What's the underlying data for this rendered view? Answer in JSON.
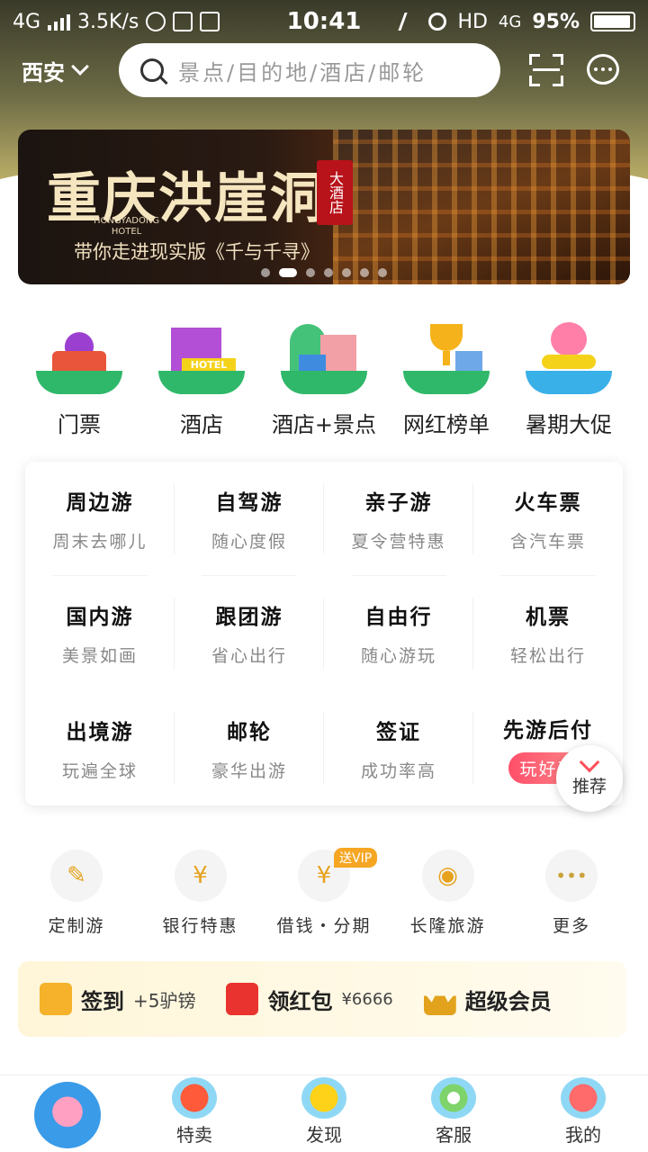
{
  "status": {
    "network": "4G",
    "speed": "3.5K/s",
    "time": "10:41",
    "hd": "HD",
    "network2": "4G",
    "battery": "95%",
    "battery_level": 0.95
  },
  "header": {
    "city": "西安",
    "search_placeholder": "景点/目的地/酒店/邮轮"
  },
  "banner": {
    "title": "重庆洪崖洞",
    "seal": "大酒店",
    "en_line1": "HONGYADONG",
    "en_line2": "HOTEL",
    "subtitle": "带你走进现实版《千与千寻》",
    "dot_count": 7,
    "active_dot": 1
  },
  "categories": [
    {
      "label": "门票",
      "icon": "temple-ticket-icon"
    },
    {
      "label": "酒店",
      "icon": "hotel-icon"
    },
    {
      "label": "酒店+景点",
      "icon": "hotel-scenic-icon"
    },
    {
      "label": "网红榜单",
      "icon": "trophy-icon"
    },
    {
      "label": "暑期大促",
      "icon": "summer-donkey-icon"
    }
  ],
  "grid": [
    {
      "title": "周边游",
      "sub": "周末去哪儿"
    },
    {
      "title": "自驾游",
      "sub": "随心度假"
    },
    {
      "title": "亲子游",
      "sub": "夏令营特惠"
    },
    {
      "title": "火车票",
      "sub": "含汽车票"
    },
    {
      "title": "国内游",
      "sub": "美景如画"
    },
    {
      "title": "跟团游",
      "sub": "省心出行"
    },
    {
      "title": "自由行",
      "sub": "随心游玩"
    },
    {
      "title": "机票",
      "sub": "轻松出行"
    },
    {
      "title": "出境游",
      "sub": "玩遍全球"
    },
    {
      "title": "邮轮",
      "sub": "豪华出游"
    },
    {
      "title": "签证",
      "sub": "成功率高"
    },
    {
      "title": "先游后付",
      "sub": "玩好再"
    }
  ],
  "recommend": {
    "label": "推荐"
  },
  "services": [
    {
      "label": "定制游",
      "icon": "pencil-icon"
    },
    {
      "label": "银行特惠",
      "icon": "bank-house-icon"
    },
    {
      "label": "借钱・分期",
      "icon": "money-bag-icon",
      "badge": "送VIP"
    },
    {
      "label": "长隆旅游",
      "icon": "tiger-icon"
    },
    {
      "label": "更多",
      "icon": "more-dots-icon"
    }
  ],
  "member": {
    "checkin": "签到",
    "checkin_reward": "+5驴镑",
    "redpacket": "领红包",
    "redpacket_amount": "¥6666",
    "vip": "超级会员"
  },
  "tabbar": [
    {
      "label": "",
      "icon": "home-donkey-icon"
    },
    {
      "label": "特卖",
      "icon": "bucket-icon"
    },
    {
      "label": "发现",
      "icon": "duck-icon"
    },
    {
      "label": "客服",
      "icon": "lifebuoy-icon"
    },
    {
      "label": "我的",
      "icon": "flipflops-icon"
    }
  ],
  "colors": {
    "accent": "#ff4f5a",
    "gold": "#f5a623",
    "green": "#2fb86a"
  }
}
